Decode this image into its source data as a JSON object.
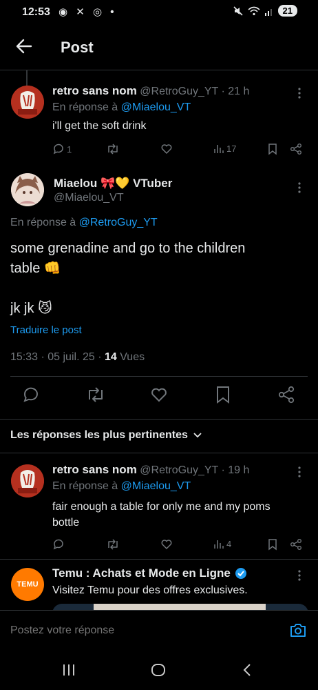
{
  "status": {
    "time": "12:53",
    "left_icons": "◉ ✕ ◎ •",
    "battery": "21"
  },
  "header": {
    "title": "Post"
  },
  "reply1": {
    "name": "retro sans nom",
    "handle_time": "@RetroGuy_YT · 21 h",
    "reply_prefix": "En réponse à ",
    "reply_to": "@Miaelou_VT",
    "text": "i'll get the soft drink",
    "replies": "1",
    "views": "17"
  },
  "main": {
    "name": "Miaelou 🎀💛 VTuber",
    "handle": "@Miaelou_VT",
    "reply_prefix": "En réponse à ",
    "reply_to": "@RetroGuy_YT",
    "text_line1": "some grenadine and go to the children",
    "text_line2": "table 👊",
    "text_line3": "jk jk 😼",
    "translate": "Traduire le post",
    "meta_time": "15:33 · 05 juil. 25 · ",
    "meta_views_count": "14",
    "meta_views_label": " Vues"
  },
  "sort": {
    "label": "Les réponses les plus pertinentes"
  },
  "reply2": {
    "name": "retro sans nom",
    "handle_time": "@RetroGuy_YT · 19 h",
    "reply_prefix": "En réponse à ",
    "reply_to": "@Miaelou_VT",
    "text_line1": "fair enough a table for only me and my poms",
    "text_line2": "bottle",
    "views": "4"
  },
  "ad": {
    "name": "Temu : Achats et Mode en Ligne",
    "text": "Visitez Temu pour des offres exclusives.",
    "logo_text": "TEMU"
  },
  "compose": {
    "placeholder": "Postez votre réponse"
  },
  "colors": {
    "accent": "#1d9bf0",
    "muted": "#71767b",
    "background": "#000000"
  }
}
